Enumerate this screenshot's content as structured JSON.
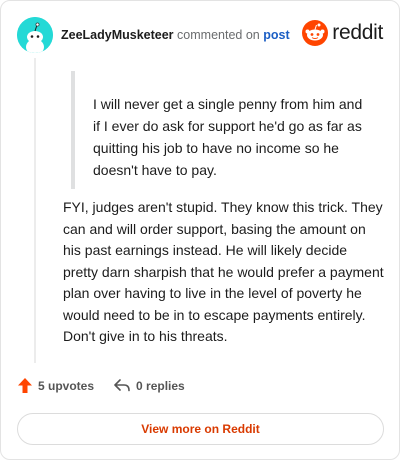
{
  "header": {
    "username": "ZeeLadyMusketeer",
    "verb": "commented on",
    "post_link": "post",
    "brand": "reddit",
    "brand_color": "#ff4500",
    "avatar_color": "#24d9d6"
  },
  "comment": {
    "quote": "I will never get a single penny from him and if I ever do ask for support he'd go as far as quitting his job to have no income so he doesn't have to pay.",
    "body": "FYI, judges aren't stupid. They know this trick. They can and will order support, basing the amount on his past earnings instead. He will likely decide pretty darn sharpish that he would prefer a payment plan over having to live in the level of poverty he would need to be in to escape payments entirely. Don't give in to his threats."
  },
  "actions": {
    "upvotes": "5 upvotes",
    "replies": "0 replies",
    "upvote_color": "#ff4500"
  },
  "footer": {
    "view_more": "View more on Reddit",
    "link_color": "#d93a00"
  }
}
